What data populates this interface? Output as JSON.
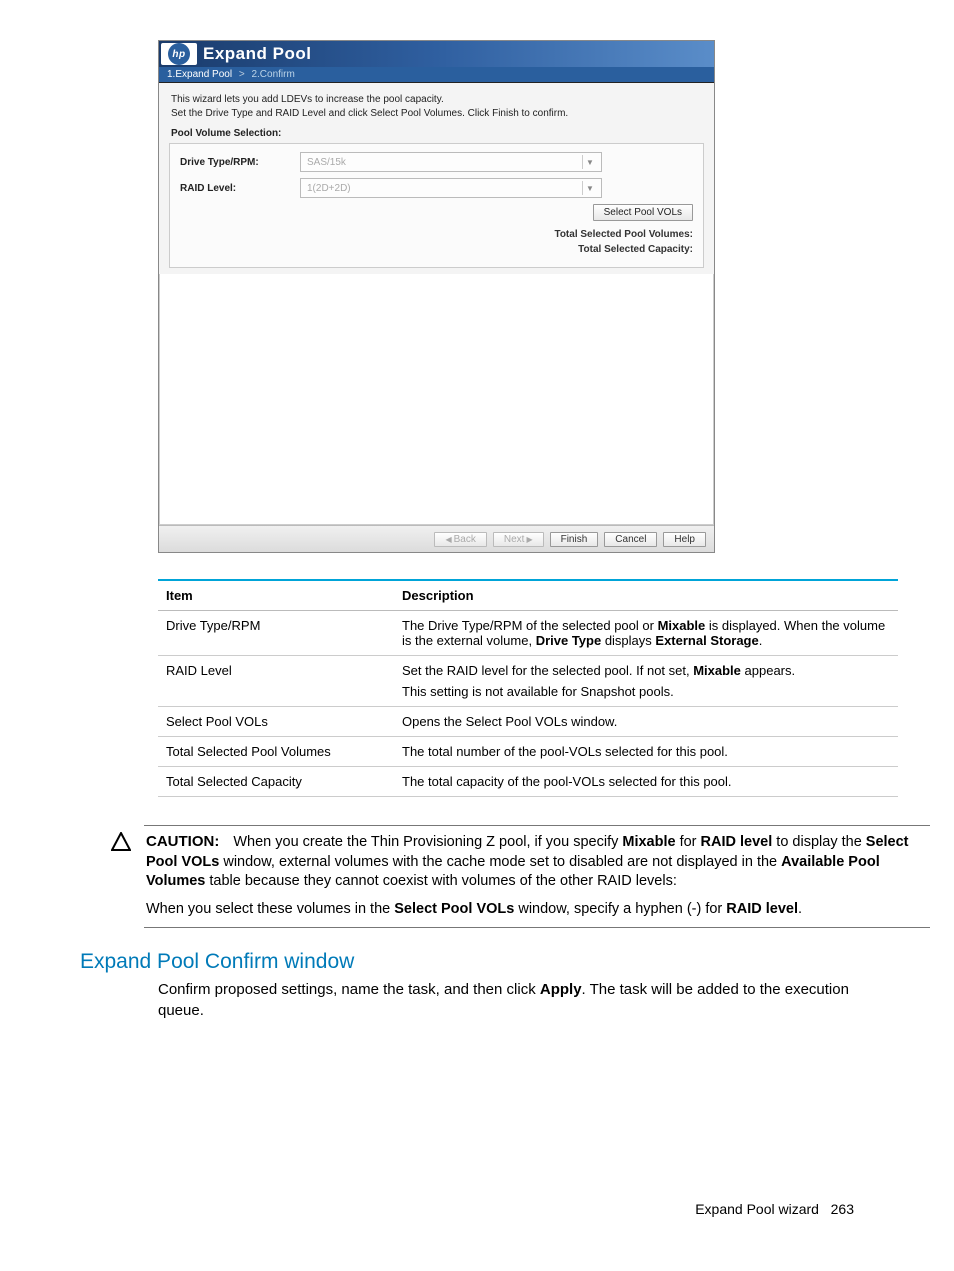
{
  "wizard": {
    "title": "Expand Pool",
    "logo_text": "hp",
    "steps": {
      "step1": "1.Expand Pool",
      "sep": ">",
      "step2": "2.Confirm"
    },
    "intro_line1": "This wizard lets you add LDEVs to increase the pool capacity.",
    "intro_line2": "Set the Drive Type and RAID Level and click Select Pool Volumes. Click Finish to confirm.",
    "section_label": "Pool Volume Selection:",
    "form": {
      "drive_type_label": "Drive Type/RPM:",
      "drive_type_value": "SAS/15k",
      "raid_label": "RAID Level:",
      "raid_value": "1(2D+2D)"
    },
    "select_btn": "Select Pool VOLs",
    "totals": {
      "volumes_label": "Total Selected Pool Volumes:",
      "capacity_label": "Total Selected Capacity:"
    },
    "footer": {
      "back": "Back",
      "next": "Next",
      "finish": "Finish",
      "cancel": "Cancel",
      "help": "Help"
    }
  },
  "table": {
    "head_item": "Item",
    "head_desc": "Description",
    "rows": [
      {
        "item": "Drive Type/RPM",
        "desc_a": "The Drive Type/RPM of the selected pool or ",
        "desc_b": "Mixable",
        "desc_c": " is displayed. When the volume is the external volume, ",
        "desc_d": "Drive Type",
        "desc_e": " displays ",
        "desc_f": "External Storage",
        "desc_g": "."
      },
      {
        "item": "RAID Level",
        "desc_a": "Set the RAID level for the selected pool. If not set, ",
        "desc_b": "Mixable",
        "desc_c": " appears.",
        "p2": "This setting is not available for Snapshot pools."
      },
      {
        "item": "Select Pool VOLs",
        "desc": "Opens the Select Pool VOLs window."
      },
      {
        "item": "Total Selected Pool Volumes",
        "desc": "The total number of the pool-VOLs selected for this pool."
      },
      {
        "item": "Total Selected Capacity",
        "desc": "The total capacity of the pool-VOLs selected for this pool."
      }
    ]
  },
  "caution": {
    "label": "CAUTION:",
    "p1_a": "When you create the Thin Provisioning Z pool, if you specify ",
    "p1_b": "Mixable",
    "p1_c": " for ",
    "p1_d": "RAID level",
    "p1_e": " to display the ",
    "p1_f": "Select Pool VOLs",
    "p1_g": " window, external volumes with the cache mode set to disabled are not displayed in the ",
    "p1_h": "Available Pool Volumes",
    "p1_i": " table because they cannot coexist with volumes of the other RAID levels:",
    "p2_a": "When you select these volumes in the ",
    "p2_b": "Select Pool VOLs",
    "p2_c": " window, specify a hyphen (-) for ",
    "p2_d": "RAID level",
    "p2_e": "."
  },
  "section_heading": "Expand Pool Confirm window",
  "section_body_a": "Confirm proposed settings, name the task, and then click ",
  "section_body_b": "Apply",
  "section_body_c": ". The task will be added to the execution queue.",
  "footer": {
    "label": "Expand Pool wizard",
    "page": "263"
  }
}
